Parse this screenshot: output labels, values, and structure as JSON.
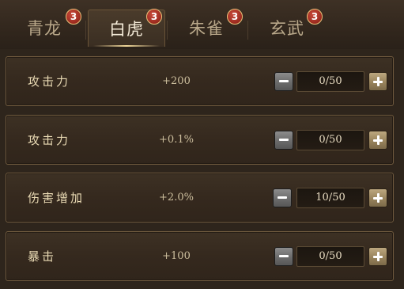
{
  "tabs": [
    {
      "label": "青龙",
      "badge": "3",
      "active": false
    },
    {
      "label": "白虎",
      "badge": "3",
      "active": true
    },
    {
      "label": "朱雀",
      "badge": "3",
      "active": false
    },
    {
      "label": "玄武",
      "badge": "3",
      "active": false
    }
  ],
  "attributes": [
    {
      "name": "攻击力",
      "bonus": "+200",
      "level": "0/50"
    },
    {
      "name": "攻击力",
      "bonus": "+0.1%",
      "level": "0/50"
    },
    {
      "name": "伤害增加",
      "bonus": "+2.0%",
      "level": "10/50"
    },
    {
      "name": "暴击",
      "bonus": "+100",
      "level": "0/50"
    }
  ],
  "colors": {
    "badge": "#9b2a1f",
    "badge_ring": "#e9c37a",
    "active_tab_text": "#f3ead7",
    "inactive_tab_text": "#b9a88a",
    "plus_button": "#98835c",
    "minus_button": "#6b6b6b"
  },
  "icons": {
    "minus": "minus-icon",
    "plus": "plus-icon"
  }
}
